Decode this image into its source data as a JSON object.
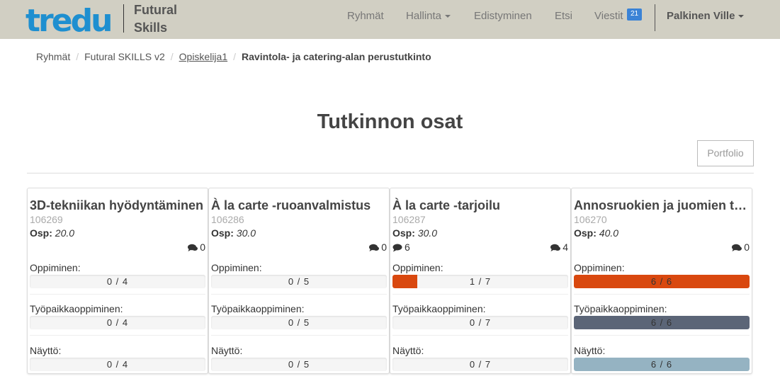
{
  "brand": {
    "logo_text": "tredu",
    "sub_line1": "Futural",
    "sub_line2": "Skills",
    "logo_color": "#1e8fd0"
  },
  "nav": {
    "items": [
      {
        "label": "Ryhmät"
      },
      {
        "label": "Hallinta"
      },
      {
        "label": "Edistyminen"
      },
      {
        "label": "Etsi"
      },
      {
        "label": "Viestit"
      }
    ],
    "messages_badge": "21",
    "user": "Palkinen Ville"
  },
  "breadcrumb": [
    {
      "label": "Ryhmät"
    },
    {
      "label": "Futural SKILLS v2"
    },
    {
      "label": "Opiskelija1"
    },
    {
      "label": "Ravintola- ja catering-alan perustutkinto"
    }
  ],
  "page": {
    "title": "Tutkinnon osat",
    "portfolio_button": "Portfolio"
  },
  "labels": {
    "osp": "Osp:",
    "oppiminen": "Oppiminen:",
    "tyopaikka": "Työpaikkaoppiminen:",
    "naytto": "Näyttö:"
  },
  "colors": {
    "oppiminen_fill": "#d9480f",
    "tyopaikka_fill": "#5b6577",
    "naytto_fill": "#95b3c2"
  },
  "cards": [
    {
      "title": "3D-tekniikan hyödyntäminen",
      "code": "106269",
      "osp": "20.0",
      "comments_right": "0",
      "comments_left": "",
      "oppiminen": {
        "text": "0 / 4",
        "fraction": 0
      },
      "tyopaikka": {
        "text": "0 / 4",
        "fraction": 0
      },
      "naytto": {
        "text": "0 / 4",
        "fraction": 0
      }
    },
    {
      "title": "À la carte -ruoanvalmistus",
      "code": "106286",
      "osp": "30.0",
      "comments_right": "0",
      "comments_left": "",
      "oppiminen": {
        "text": "0 / 5",
        "fraction": 0
      },
      "tyopaikka": {
        "text": "0 / 5",
        "fraction": 0
      },
      "naytto": {
        "text": "0 / 5",
        "fraction": 0
      }
    },
    {
      "title": "À la carte -tarjoilu",
      "code": "106287",
      "osp": "30.0",
      "comments_right": "4",
      "comments_left": "6",
      "oppiminen": {
        "text": "1 / 7",
        "fraction": 0.143
      },
      "tyopaikka": {
        "text": "0 / 7",
        "fraction": 0
      },
      "naytto": {
        "text": "0 / 7",
        "fraction": 0
      }
    },
    {
      "title": "Annosruokien ja juomien tarjoilu",
      "code": "106270",
      "osp": "40.0",
      "comments_right": "0",
      "comments_left": "",
      "oppiminen": {
        "text": "6 / 6",
        "fraction": 1
      },
      "tyopaikka": {
        "text": "6 / 6",
        "fraction": 1
      },
      "naytto": {
        "text": "6 / 6",
        "fraction": 1
      }
    }
  ]
}
